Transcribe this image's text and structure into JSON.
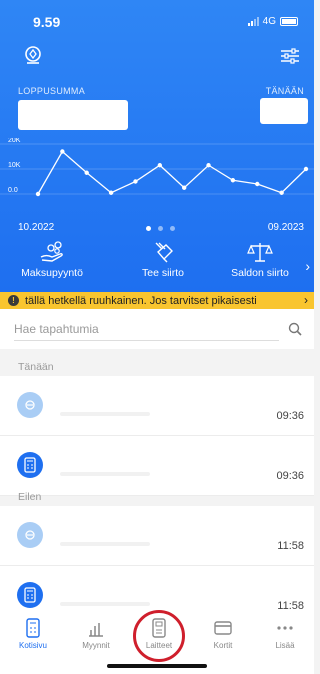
{
  "status_bar": {
    "time": "9.59",
    "network": "4G"
  },
  "summary": {
    "left_label": "LOPPUSUMMA",
    "right_label": "TÄNÄÄN"
  },
  "chart_data": {
    "type": "line",
    "title": "",
    "xlabel": "",
    "ylabel": "",
    "y_ticks": [
      "20K",
      "10K",
      "0.0"
    ],
    "ylim": [
      0,
      20000
    ],
    "x_start_label": "10.2022",
    "x_end_label": "09.2023",
    "series": [
      {
        "values": [
          0,
          17000,
          8500,
          500,
          5000,
          11500,
          2500,
          11500,
          5500,
          4000,
          500,
          10000
        ]
      }
    ],
    "grid": true
  },
  "carousel": {
    "pages": 3,
    "active": 0
  },
  "actions": [
    {
      "label": "Maksupyyntö",
      "icon": "hand-coins-icon"
    },
    {
      "label": "Tee siirto",
      "icon": "transfer-icon"
    },
    {
      "label": "Saldon siirto",
      "icon": "scales-icon"
    }
  ],
  "banner": {
    "text": "tällä hetkellä ruuhkainen. Jos tarvitset pikaisesti"
  },
  "search": {
    "placeholder": "Hae tapahtumia"
  },
  "sections": {
    "today": "Tänään",
    "yesterday": "Eilen"
  },
  "transactions": [
    {
      "time": "09:36",
      "type": "light"
    },
    {
      "time": "09:36",
      "type": "pos"
    },
    {
      "time": "11:58",
      "type": "light"
    },
    {
      "time": "11:58",
      "type": "pos"
    }
  ],
  "nav": {
    "items": [
      {
        "label": "Kotisivu",
        "active": true
      },
      {
        "label": "Myynnit",
        "active": false
      },
      {
        "label": "Laitteet",
        "active": false
      },
      {
        "label": "Kortit",
        "active": false
      },
      {
        "label": "Lisää",
        "active": false
      }
    ]
  },
  "colors": {
    "brand_blue": "#1e6ff0",
    "banner_yellow": "#f9c52f",
    "highlight_red": "#cf1f2c"
  }
}
